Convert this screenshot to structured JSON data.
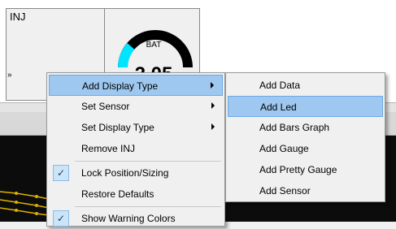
{
  "panels": {
    "inj": {
      "label": "INJ",
      "arrow": "»"
    },
    "bat": {
      "label": "BAT",
      "value_partial": "2.05",
      "gauge_fraction": 0.3,
      "gauge_color": "#00e5ff"
    }
  },
  "context_menu": {
    "items": [
      {
        "label": "Add Display Type",
        "has_submenu": true,
        "highlighted": true
      },
      {
        "label": "Set Sensor",
        "has_submenu": true
      },
      {
        "label": "Set Display Type",
        "has_submenu": true
      },
      {
        "label": "Remove INJ"
      },
      {
        "label": "Lock Position/Sizing",
        "checked": true
      },
      {
        "label": "Restore Defaults"
      },
      {
        "label": "Show Warning Colors",
        "checked": true
      }
    ]
  },
  "submenu": {
    "items": [
      {
        "label": "Add Data"
      },
      {
        "label": "Add Led",
        "highlighted": true
      },
      {
        "label": "Add Bars Graph"
      },
      {
        "label": "Add Gauge"
      },
      {
        "label": "Add Pretty Gauge"
      },
      {
        "label": "Add Sensor"
      }
    ]
  },
  "colors": {
    "highlight": "#9ec8f0",
    "plot_background": "#0c0c0c",
    "plot_line": "#e0b000"
  }
}
